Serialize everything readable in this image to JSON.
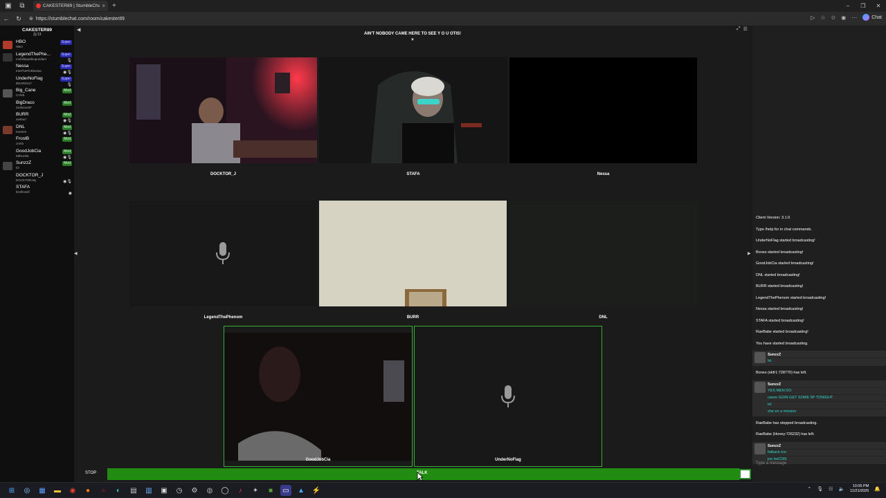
{
  "browser": {
    "tab_title": "CAKESTER89 | StumbleChat",
    "url": "https://stumblechat.com/room/cakester89",
    "chat_button": "Chat"
  },
  "room": {
    "name": "CAKESTER89",
    "count": "🎥13",
    "topic": "AIN'T NOBODY CAME HERE TO SEE Y O U OTIS!"
  },
  "users": [
    {
      "name": "HBO",
      "sub": "HBO",
      "badge": "Super",
      "icons": "",
      "avatar": "#b23a2a"
    },
    {
      "name": "LegendThePhe...",
      "sub": "mobilitepathiopundam",
      "badge": "Super",
      "icons": "🎙",
      "avatar": "#333"
    },
    {
      "name": "Nessa",
      "sub": "IntoThePinkNessa",
      "badge": "Super",
      "icons": "◉🎙",
      "avatar": ""
    },
    {
      "name": "UnderNoFlag",
      "sub": "BNARD117",
      "badge": "Super",
      "icons": "🎙",
      "avatar": ""
    },
    {
      "name": "Big_Cane",
      "sub": "CANE",
      "badge": "Mod",
      "icons": "",
      "avatar": "#555"
    },
    {
      "name": "BigDraco",
      "sub": "2wilsonsSF",
      "badge": "Mod",
      "icons": "",
      "avatar": ""
    },
    {
      "name": "BURR",
      "sub": "aveburr",
      "badge": "Mod",
      "icons": "◉🎙",
      "avatar": ""
    },
    {
      "name": "DNL",
      "sub": "Kaseen",
      "badge": "Mod",
      "icons": "◉🎙",
      "avatar": "#7a3a2a"
    },
    {
      "name": "FrostB",
      "sub": "Jomb",
      "badge": "Mod",
      "icons": "",
      "avatar": ""
    },
    {
      "name": "GoodJobCia",
      "sub": "MthLeela",
      "badge": "Mod",
      "icons": "◉🎙",
      "avatar": ""
    },
    {
      "name": "SunzzZ",
      "sub": "lol",
      "badge": "Mod",
      "icons": "",
      "avatar": "#444"
    },
    {
      "name": "DOCKTOR_J",
      "sub": "DOCKTORJay",
      "badge": "",
      "icons": "◉🎙",
      "avatar": ""
    },
    {
      "name": "STAFA",
      "sub": "brothrwell",
      "badge": "",
      "icons": "◉",
      "avatar": ""
    }
  ],
  "cams": {
    "row1": [
      "DOCKTOR_J",
      "STAFA",
      "Nessa"
    ],
    "row2": [
      "LegendThePhenom",
      "BURR",
      "DNL"
    ],
    "row3": [
      "GoodJobCia",
      "UnderNoFlag"
    ]
  },
  "controls": {
    "stop": "STOP",
    "talk": "TALK"
  },
  "chat": {
    "system_top": [
      "Client Version: 3.1.0",
      "Type /help for in chat commands.",
      "UnderNoFlag started broadcasting!",
      "Bones started broadcasting!",
      "GoodJobCia started broadcasting!",
      "DNL started broadcasting!",
      "BURR started broadcasting!",
      "LegendThePhenom started broadcasting!",
      "Nessa started broadcasting!",
      "STAFA started broadcasting!",
      "RaeBabe started broadcasting!",
      "You have started broadcasting."
    ],
    "msg1": {
      "who": "SunzzZ",
      "lines": [
        "lol"
      ]
    },
    "sys2": "Bones (ekfr1:728770) has left.",
    "msg2": {
      "who": "SunzzZ",
      "lines": [
        "YES MEN DO",
        "raeee GOIN GET SOME 9P TONIGHT",
        "lol",
        "she on a mission"
      ]
    },
    "sys3": "RaeBabe has stopped broadcasting.",
    "sys4": "RaeBabe (Honey:726232) has left.",
    "msg3": {
      "who": "SunzzZ",
      "lines": [
        "fatback too",
        "joe baCON"
      ]
    },
    "input_placeholder": "Type a message"
  },
  "clock": {
    "time": "10:05 PM",
    "date": "11/21/2025"
  }
}
